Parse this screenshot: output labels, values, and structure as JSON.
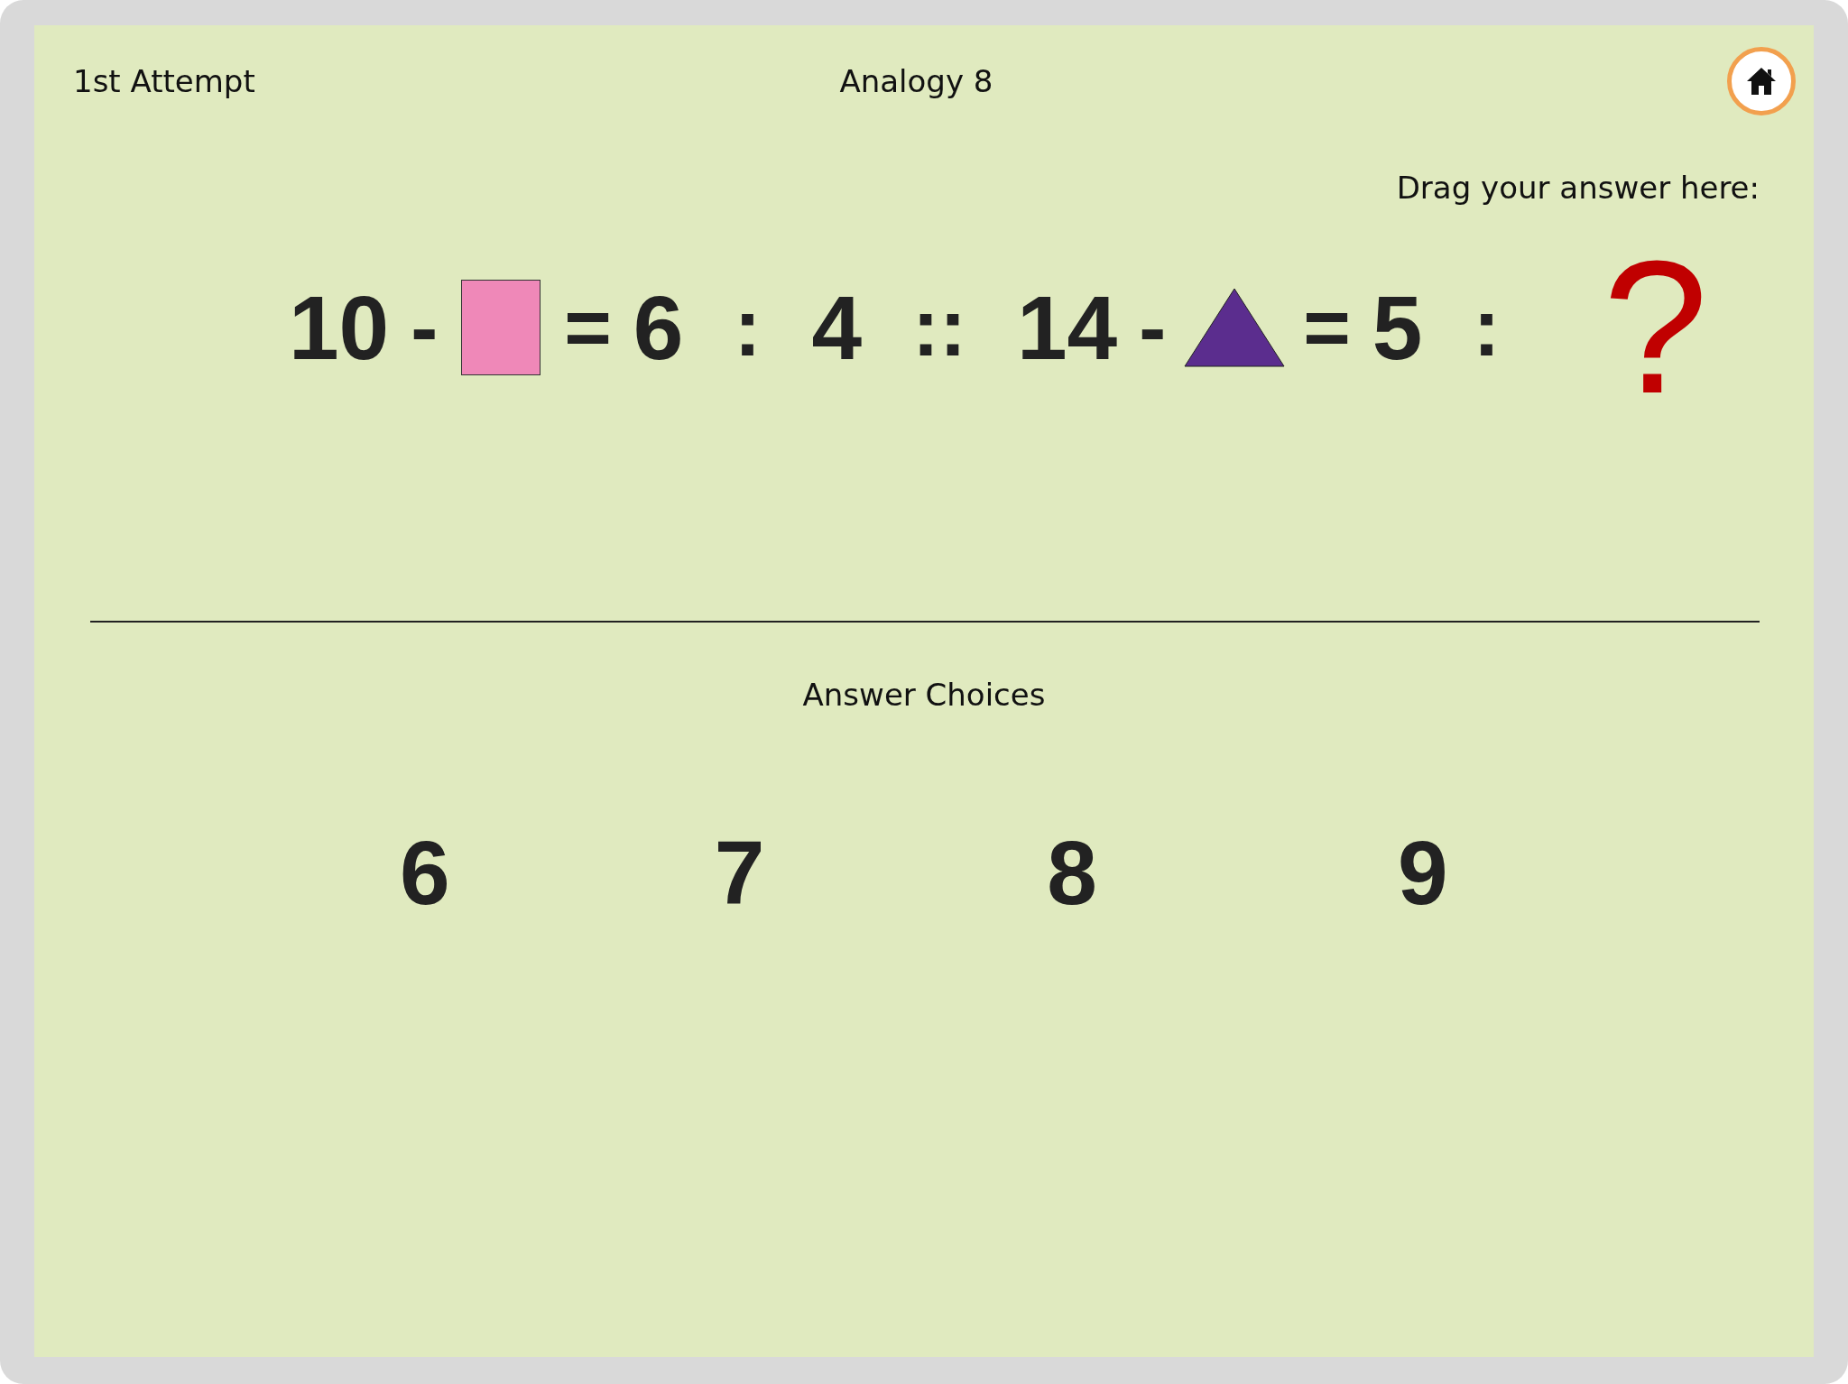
{
  "header": {
    "attempt": "1st Attempt",
    "title": "Analogy 8"
  },
  "drop_hint": "Drag your answer here:",
  "equation": [
    {
      "kind": "number",
      "text": "10"
    },
    {
      "kind": "operator",
      "text": "-"
    },
    {
      "kind": "square",
      "color": "#ef88b8"
    },
    {
      "kind": "operator",
      "text": "="
    },
    {
      "kind": "number",
      "text": "6"
    },
    {
      "kind": "separator",
      "text": ":"
    },
    {
      "kind": "number",
      "text": "4"
    },
    {
      "kind": "separator",
      "text": "::"
    },
    {
      "kind": "number",
      "text": "14"
    },
    {
      "kind": "operator",
      "text": "-"
    },
    {
      "kind": "triangle",
      "color": "#5b2d8e"
    },
    {
      "kind": "operator",
      "text": "="
    },
    {
      "kind": "number",
      "text": "5"
    },
    {
      "kind": "separator",
      "text": ":"
    },
    {
      "kind": "slot",
      "text": "?"
    }
  ],
  "choices_title": "Answer Choices",
  "choices": [
    "6",
    "7",
    "8",
    "9"
  ]
}
